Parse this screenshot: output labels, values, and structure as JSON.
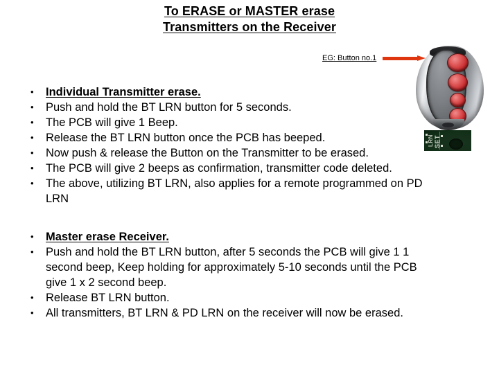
{
  "title": {
    "line1": "To ERASE or MASTER erase",
    "line2": "Transmitters on the Receiver"
  },
  "callout": {
    "label": "EG: Button no.1",
    "arrow_color": "#e0360f"
  },
  "remote": {
    "name": "four-button remote key fob",
    "button_count": 4,
    "button_color": "#c4262a",
    "body_color": "#b9bcc1"
  },
  "pcb": {
    "name": "receiver circuit board close-up",
    "board_color": "#16301c",
    "silk_text_1": "SET",
    "silk_text_2": "LRN"
  },
  "sections": [
    {
      "id": "individual-transmitter-erase",
      "bullets": [
        {
          "text": "Individual Transmitter erase.",
          "style": "head"
        },
        {
          "text": "Push and hold the BT LRN button for 5 seconds.",
          "style": "body"
        },
        {
          "text": "The PCB will give 1 Beep.",
          "style": "body"
        },
        {
          "text": "Release the BT LRN button once the PCB has beeped.",
          "style": "body"
        },
        {
          "text": "Now push & release the Button on the Transmitter to be erased.",
          "style": "body"
        },
        {
          "text": "The PCB will give 2 beeps as confirmation, transmitter code deleted.",
          "style": "body"
        },
        {
          "text": "The above, utilizing BT LRN, also applies for a remote programmed on PD\nLRN",
          "style": "body"
        }
      ]
    },
    {
      "id": "master-erase-receiver",
      "bullets": [
        {
          "text": "Master erase Receiver.",
          "style": "head"
        },
        {
          "text": "Push and hold the BT LRN button, after 5 seconds the PCB will give 1 1\nsecond beep, Keep holding for approximately 5-10 seconds until the PCB\ngive 1 x 2 second beep.",
          "style": "body"
        },
        {
          "text": "Release BT LRN button.",
          "style": "body"
        },
        {
          "text": "All transmitters, BT LRN & PD LRN on the receiver will now be erased.",
          "style": "body"
        }
      ]
    }
  ],
  "bullet_glyph": "•"
}
